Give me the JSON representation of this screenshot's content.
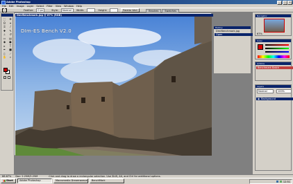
{
  "window": {
    "title": "Adobe Photoshop"
  },
  "menu": [
    "File",
    "Edit",
    "Image",
    "Layer",
    "Select",
    "Filter",
    "View",
    "Window",
    "Help"
  ],
  "options": {
    "feather_label": "Feather:",
    "feather_value": "0 px",
    "style_label": "Style:",
    "style_value": "Normal",
    "width_label": "Width:",
    "height_label": "Height:",
    "palette_btn": "Palette Well",
    "tabs": [
      "Brushes",
      "Swatches"
    ]
  },
  "document": {
    "title": "DmrBenchmark.jpg @ 67% (RGB)",
    "watermark": "DIm-ES Bench V2.0"
  },
  "panels": {
    "navigator": {
      "title": "Navigator",
      "zoom": "67%"
    },
    "history": {
      "title": "History",
      "items": [
        "DmrBenchmark.jpg",
        "Open"
      ]
    },
    "color": {
      "title": "Color"
    },
    "actions": {
      "title": "Actions",
      "item": "Benchmark Batch"
    },
    "layers": {
      "title": "Layers",
      "mode": "Normal",
      "opacity": "100%",
      "layer": "Background"
    }
  },
  "status": {
    "zoom": "66.67%",
    "doc_size": "Doc: 2.25M/2.25M",
    "hint": "Click and drag to draw a rectangular selection. Use Shift, Alt, and Ctrl for additional options."
  },
  "taskbar": {
    "start": "Start",
    "tasks": [
      "Adobe Photoshop",
      "Macromedia Dreamweaver",
      "BenchMark"
    ],
    "clock": "12:51"
  },
  "colors": {
    "fg": "#d40000",
    "bg": "#ffffff",
    "accent": "#0a246a"
  }
}
